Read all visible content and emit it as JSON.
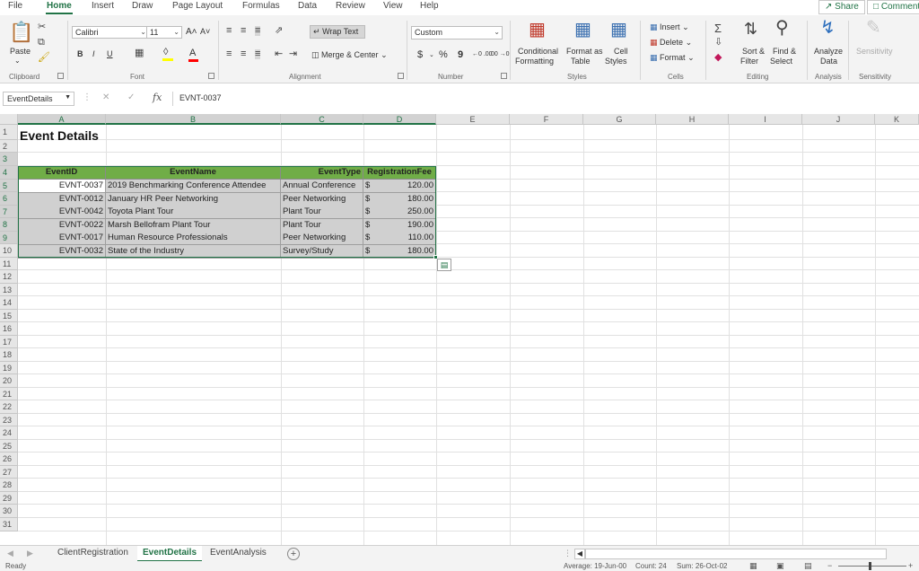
{
  "menu": {
    "tabs": [
      "File",
      "Home",
      "Insert",
      "Draw",
      "Page Layout",
      "Formulas",
      "Data",
      "Review",
      "View",
      "Help"
    ],
    "active": "Home",
    "share": "Share",
    "comments": "Comments"
  },
  "ribbon": {
    "clipboard": {
      "label": "Clipboard",
      "paste": "Paste"
    },
    "font": {
      "label": "Font",
      "name": "Calibri",
      "size": "11",
      "bold": "B",
      "italic": "I",
      "underline": "U",
      "grow": "A˄",
      "shrink": "A˅",
      "fill_color": "#ffff00",
      "font_color": "#ff0000"
    },
    "alignment": {
      "label": "Alignment",
      "wrap_text": "Wrap Text",
      "merge_center": "Merge & Center"
    },
    "number": {
      "label": "Number",
      "format": "Custom",
      "currency": "$",
      "percent": "%",
      "comma": "9",
      "inc_decimal": "←0 .00",
      "dec_decimal": ".00 →0"
    },
    "styles": {
      "label": "Styles",
      "conditional": "Conditional",
      "formatting": "Formatting",
      "format_as": "Format as",
      "table": "Table",
      "cell": "Cell",
      "styles": "Styles"
    },
    "cells": {
      "label": "Cells",
      "insert": "Insert",
      "delete": "Delete",
      "format": "Format"
    },
    "editing": {
      "label": "Editing",
      "sort_filter_1": "Sort &",
      "sort_filter_2": "Filter",
      "find_select_1": "Find &",
      "find_select_2": "Select"
    },
    "analysis": {
      "label": "Analysis",
      "analyze_1": "Analyze",
      "analyze_2": "Data"
    },
    "sensitivity": {
      "label": "Sensitivity",
      "button": "Sensitivity"
    }
  },
  "formula_bar": {
    "name_box": "EventDetails",
    "fx": "fx",
    "value": "EVNT-0037"
  },
  "sheet": {
    "columns": [
      "A",
      "B",
      "C",
      "D",
      "E",
      "F",
      "G",
      "H",
      "I",
      "J",
      "K"
    ],
    "rows": [
      "1",
      "2",
      "3",
      "4",
      "5",
      "6",
      "7",
      "8",
      "9",
      "10",
      "11",
      "12",
      "13",
      "14",
      "15",
      "16",
      "17",
      "18",
      "19",
      "20",
      "21",
      "22",
      "23",
      "24",
      "25",
      "26",
      "27",
      "28",
      "29",
      "30",
      "31"
    ],
    "title": "Event Details",
    "table_headers": [
      "EventID",
      "EventName",
      "EventType",
      "RegistrationFee"
    ],
    "table_rows": [
      [
        "EVNT-0037",
        "2019 Benchmarking Conference Attendee",
        "Annual Conference",
        "$",
        "120.00"
      ],
      [
        "EVNT-0012",
        "January HR Peer Networking",
        "Peer Networking",
        "$",
        "180.00"
      ],
      [
        "EVNT-0042",
        "Toyota Plant Tour",
        "Plant Tour",
        "$",
        "250.00"
      ],
      [
        "EVNT-0022",
        "Marsh Bellofram Plant Tour",
        "Plant Tour",
        "$",
        "190.00"
      ],
      [
        "EVNT-0017",
        "Human Resource Professionals",
        "Peer Networking",
        "$",
        "110.00"
      ],
      [
        "EVNT-0032",
        "State of the Industry",
        "Survey/Study",
        "$",
        "180.00"
      ]
    ],
    "header_color": "#70ad47",
    "selected_fill": "#d0d0d0"
  },
  "tabs": {
    "sheets": [
      "ClientRegistration",
      "EventDetails",
      "EventAnalysis"
    ],
    "active": "EventDetails",
    "add": "+"
  },
  "status": {
    "mode": "Ready",
    "average": "Average: 19-Jun-00",
    "count": "Count: 24",
    "sum": "Sum: 26-Oct-02"
  }
}
